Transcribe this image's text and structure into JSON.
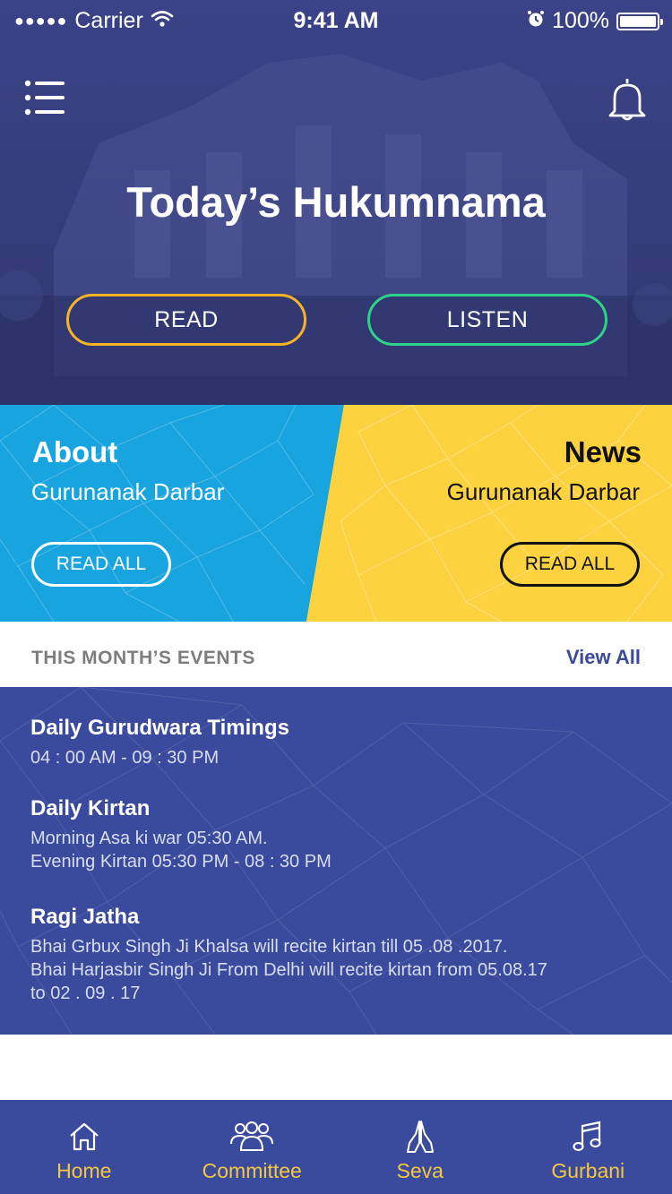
{
  "status_bar": {
    "signal": "●●●●●",
    "carrier": "Carrier",
    "time": "9:41 AM",
    "battery": "100%",
    "battery_level": 1.0
  },
  "header": {
    "title": "Today’s Hukumnama",
    "read_label": "READ",
    "listen_label": "LISTEN"
  },
  "about": {
    "title": "About",
    "subtitle": "Gurunanak Darbar",
    "button": "READ ALL"
  },
  "news": {
    "title": "News",
    "subtitle": "Gurunanak Darbar",
    "button": "READ ALL"
  },
  "events_section": {
    "heading": "THIS MONTH’S EVENTS",
    "view_all": "View All",
    "items": [
      {
        "title": "Daily Gurudwara Timings",
        "lines": [
          "04 : 00 AM - 09 : 30 PM"
        ]
      },
      {
        "title": "Daily Kirtan",
        "lines": [
          "Morning Asa ki war 05:30 AM.",
          "Evening Kirtan 05:30 PM - 08 : 30 PM"
        ]
      },
      {
        "title": "Ragi Jatha",
        "lines": [
          "Bhai Grbux Singh Ji Khalsa will recite kirtan till 05 .08 .2017.",
          "Bhai Harjasbir Singh Ji From Delhi will recite kirtan from 05.08.17",
          "to 02 . 09 . 17"
        ]
      }
    ]
  },
  "tabs": [
    {
      "label": "Home",
      "icon": "home-icon"
    },
    {
      "label": "Committee",
      "icon": "group-icon"
    },
    {
      "label": "Seva",
      "icon": "praying-hands-icon"
    },
    {
      "label": "Gurbani",
      "icon": "music-note-icon"
    }
  ],
  "colors": {
    "hero": "#3a4284",
    "about_bg": "#18a4de",
    "news_bg": "#fdd23f",
    "events_bg": "#3a4a9c",
    "tab_label": "#f5c842",
    "read_outline": "#f7b326",
    "listen_outline": "#2fd28c"
  }
}
